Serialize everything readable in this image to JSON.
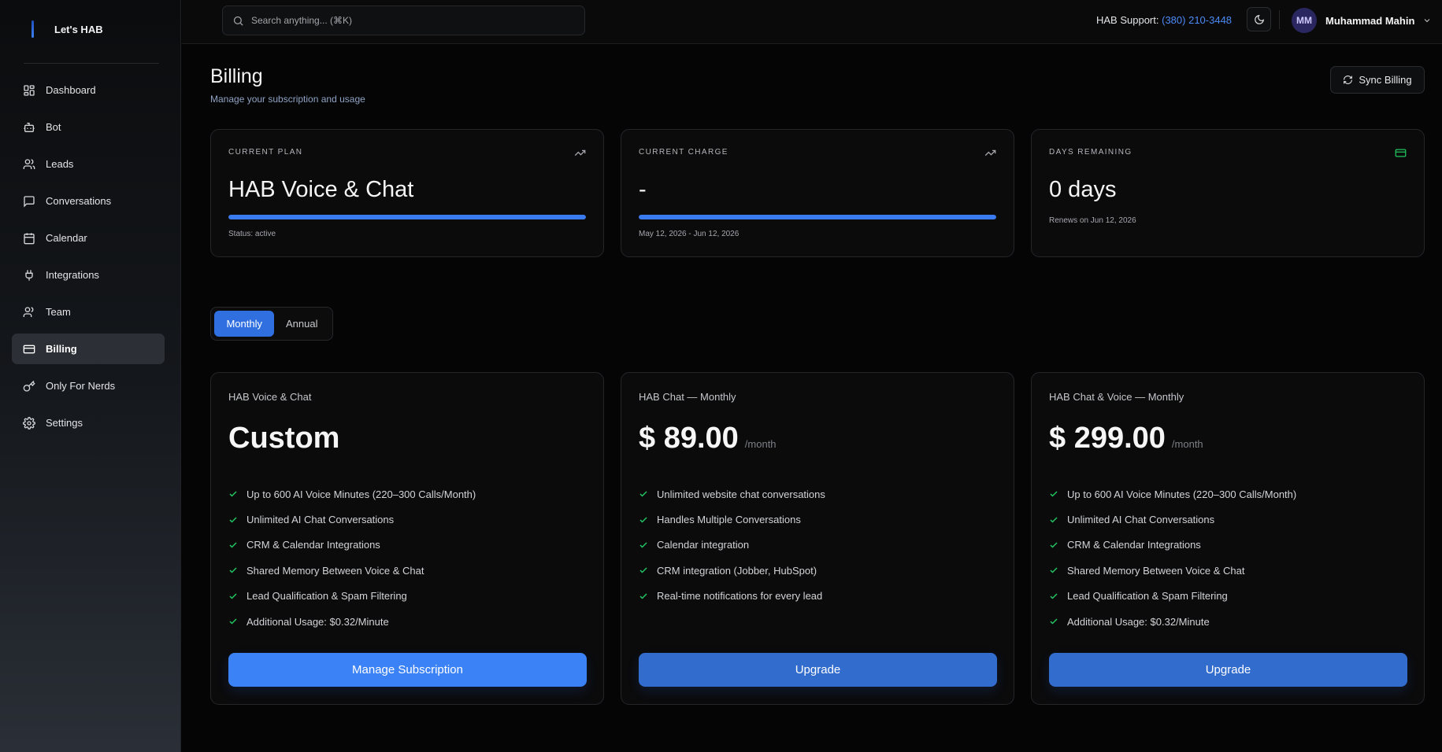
{
  "sidebar": {
    "brand": "Let's HAB",
    "items": [
      {
        "label": "Dashboard",
        "icon": "dashboard-icon",
        "active": false
      },
      {
        "label": "Bot",
        "icon": "bot-icon",
        "active": false
      },
      {
        "label": "Leads",
        "icon": "users-icon",
        "active": false
      },
      {
        "label": "Conversations",
        "icon": "chat-icon",
        "active": false
      },
      {
        "label": "Calendar",
        "icon": "calendar-icon",
        "active": false
      },
      {
        "label": "Integrations",
        "icon": "plug-icon",
        "active": false
      },
      {
        "label": "Team",
        "icon": "team-icon",
        "active": false
      },
      {
        "label": "Billing",
        "icon": "credit-card-icon",
        "active": true
      },
      {
        "label": "Only For Nerds",
        "icon": "key-icon",
        "active": false
      },
      {
        "label": "Settings",
        "icon": "gear-icon",
        "active": false
      }
    ]
  },
  "topbar": {
    "search_placeholder": "Search anything... (⌘K)",
    "support_label": "HAB Support:",
    "support_phone": "(380) 210-3448",
    "user_initials": "MM",
    "user_name": "Muhammad Mahin"
  },
  "page": {
    "title": "Billing",
    "subtitle": "Manage your subscription and usage",
    "sync_label": "Sync Billing"
  },
  "stats": [
    {
      "label": "CURRENT PLAN",
      "value": "HAB Voice & Chat",
      "note": "Status: active",
      "progress": 1.0,
      "icon": "trending-up-icon"
    },
    {
      "label": "CURRENT CHARGE",
      "value": "-",
      "note": "May 12, 2026 - Jun 12, 2026",
      "progress": 1.0,
      "icon": "trending-up-icon"
    },
    {
      "label": "DAYS REMAINING",
      "value": "0 days",
      "note": "Renews on Jun 12, 2026",
      "icon": "credit-card-icon"
    }
  ],
  "billing_toggle": {
    "monthly": "Monthly",
    "annual": "Annual",
    "selected": "Monthly"
  },
  "plans": [
    {
      "name": "HAB Voice & Chat",
      "price": "Custom",
      "unit": "",
      "features": [
        "Up to 600 AI Voice Minutes (220–300 Calls/Month)",
        "Unlimited AI Chat Conversations",
        "CRM & Calendar Integrations",
        "Shared Memory Between Voice & Chat",
        "Lead Qualification & Spam Filtering",
        "Additional Usage: $0.32/Minute"
      ],
      "button": "Manage Subscription"
    },
    {
      "name": "HAB Chat — Monthly",
      "price": "$ 89.00",
      "unit": "/month",
      "features": [
        "Unlimited website chat conversations",
        "Handles Multiple Conversations",
        "Calendar integration",
        "CRM integration (Jobber, HubSpot)",
        "Real-time notifications for every lead"
      ],
      "button": "Upgrade"
    },
    {
      "name": "HAB Chat & Voice — Monthly",
      "price": "$ 299.00",
      "unit": "/month",
      "features": [
        "Up to 600 AI Voice Minutes (220–300 Calls/Month)",
        "Unlimited AI Chat Conversations",
        "CRM & Calendar Integrations",
        "Shared Memory Between Voice & Chat",
        "Lead Qualification & Spam Filtering",
        "Additional Usage: $0.32/Minute"
      ],
      "button": "Upgrade"
    }
  ],
  "colors": {
    "accent": "#3b82f6",
    "check": "#22c55e",
    "card_icon_green": "#22c55e"
  }
}
